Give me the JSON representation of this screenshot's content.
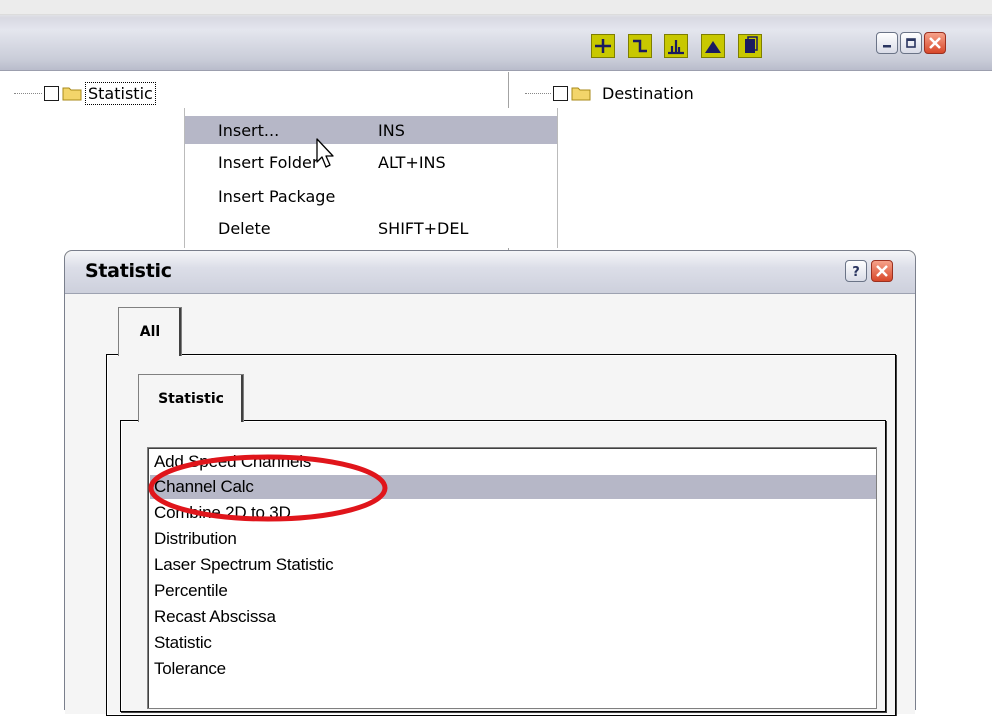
{
  "left_tree": {
    "root_label": "Statistic"
  },
  "right_tree": {
    "root_label": "Destination"
  },
  "context_menu": {
    "items": [
      {
        "label": "Insert...",
        "shortcut": "INS"
      },
      {
        "label": "Insert Folder",
        "shortcut": "ALT+INS"
      },
      {
        "label": "Insert Package",
        "shortcut": ""
      },
      {
        "label": "Delete",
        "shortcut": "SHIFT+DEL"
      }
    ],
    "highlighted_index": 0
  },
  "dialog": {
    "title": "Statistic",
    "outer_tab": "All",
    "inner_tab": "Statistic",
    "list": {
      "items": [
        "Add Speed Channels",
        "Channel Calc",
        "Combine 2D to 3D",
        "Distribution",
        "Laser Spectrum Statistic",
        "Percentile",
        "Recast Abscissa",
        "Statistic",
        "Tolerance"
      ],
      "selected": "Channel Calc"
    }
  },
  "toolbar": {
    "icons": [
      "crosshair-icon",
      "step-icon",
      "spectrum-icon",
      "peak-icon",
      "page-icon"
    ]
  },
  "colors": {
    "highlight": "#b6b7c7",
    "toolbar_icon_bg": "#c8c800",
    "annotation": "#e0151b"
  }
}
